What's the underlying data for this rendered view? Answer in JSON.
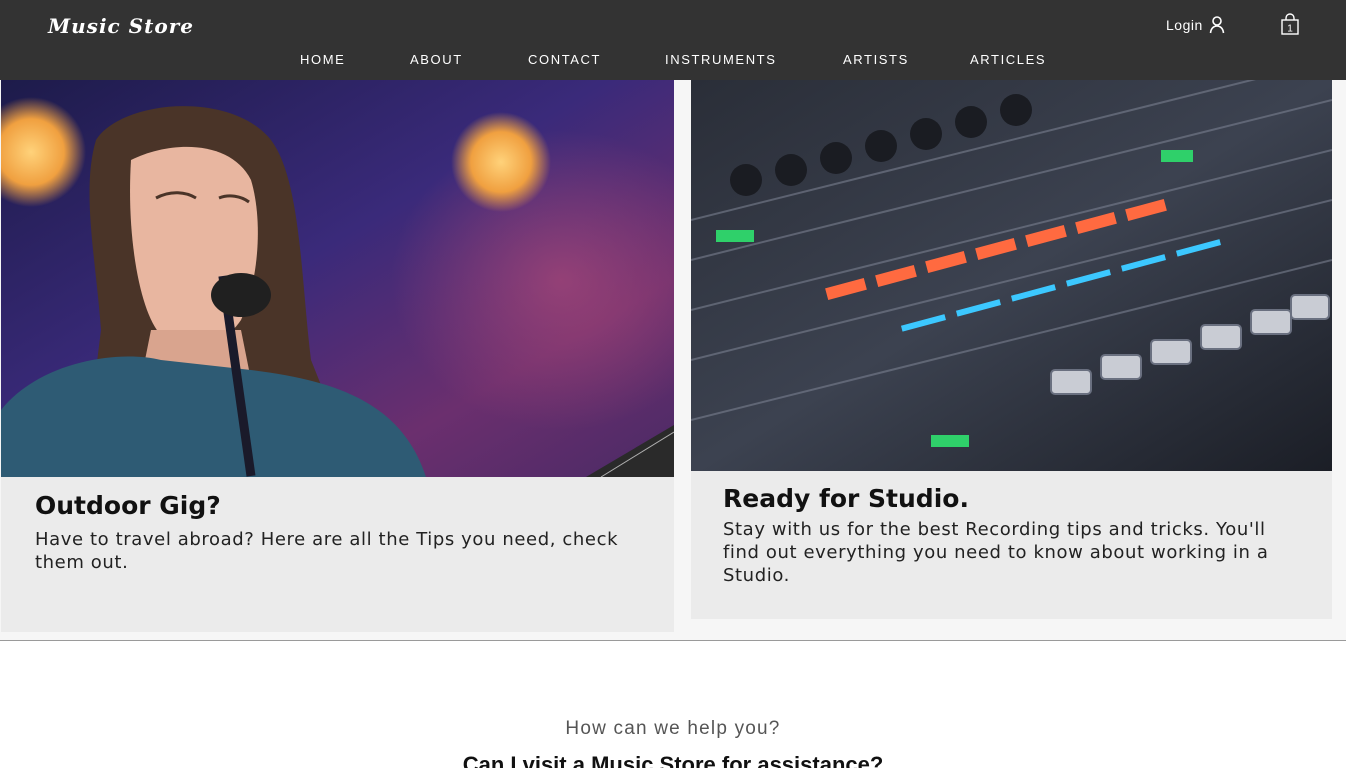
{
  "header": {
    "logo": "Music Store",
    "login_label": "Login",
    "user_icon": "user-icon",
    "cart_icon": "shopping-bag-icon",
    "cart_count": "1",
    "background": "#333333"
  },
  "nav": {
    "items": [
      {
        "label": "HOME"
      },
      {
        "label": "ABOUT"
      },
      {
        "label": "CONTACT"
      },
      {
        "label": "INSTRUMENTS"
      },
      {
        "label": "ARTISTS"
      },
      {
        "label": "ARTICLES"
      }
    ]
  },
  "cards": [
    {
      "title": "Outdoor Gig?",
      "text": "Have to travel abroad? Here are all the Tips you need, check them out."
    },
    {
      "title": "Ready for Studio.",
      "text": "Stay with us for the best Recording tips and tricks. You'll find out everything you need to know about working in a Studio."
    }
  ],
  "help": {
    "subtitle": "How can we help you?",
    "title": "Can I visit a Music Store for assistance?"
  }
}
